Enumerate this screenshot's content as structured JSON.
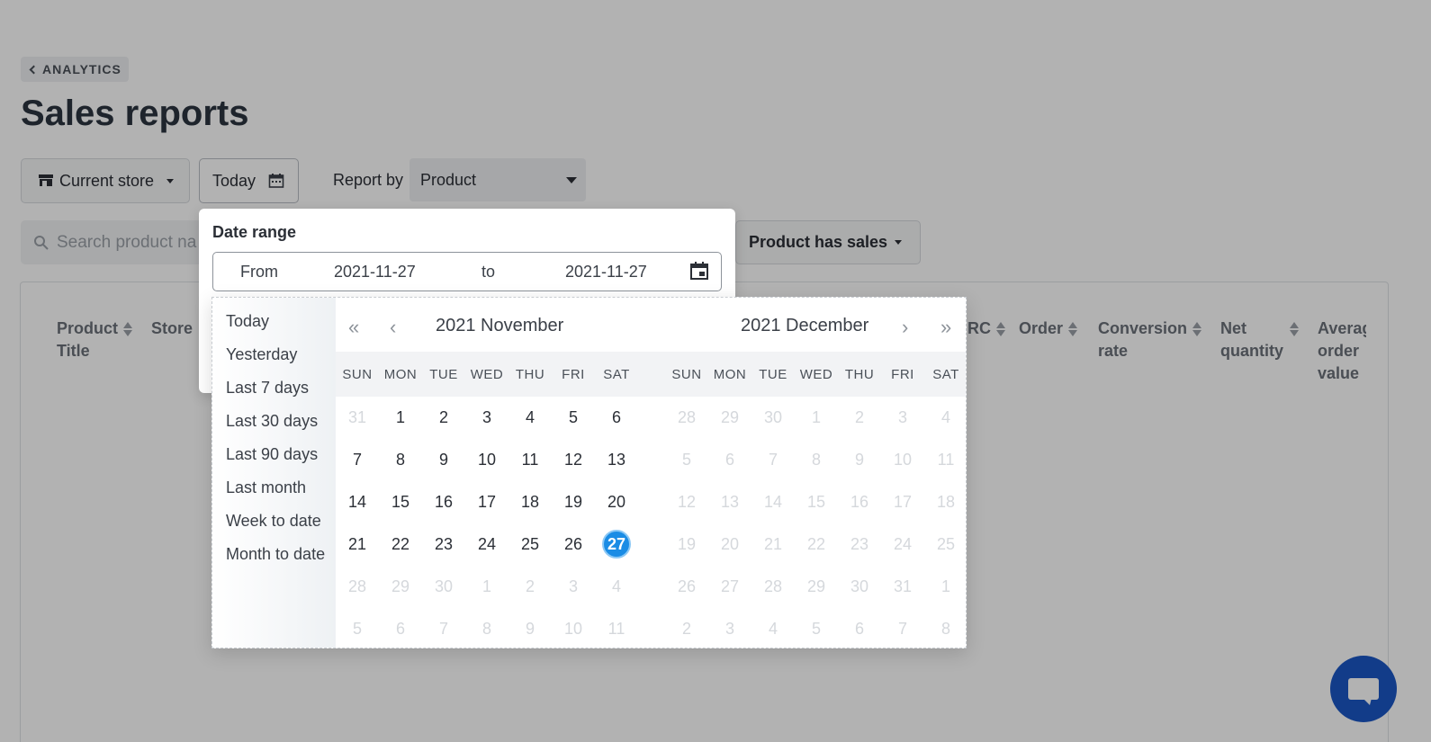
{
  "header": {
    "back_label": "ANALYTICS",
    "title": "Sales reports"
  },
  "toolbar": {
    "store_label": "Current store",
    "date_label": "Today",
    "report_by_label": "Report by",
    "report_by_value": "Product"
  },
  "filters": {
    "search_placeholder": "Search product na",
    "filter_label": "Product has sales"
  },
  "table": {
    "headers": [
      {
        "line1": "Product",
        "line2": "Title",
        "sortable": true
      },
      {
        "line1": "Store",
        "line2": "",
        "sortable": false
      },
      {
        "line1": "RC",
        "line2": "",
        "sortable": true
      },
      {
        "line1": "Order",
        "line2": "",
        "sortable": true
      },
      {
        "line1": "Conversion",
        "line2": "rate",
        "sortable": true
      },
      {
        "line1": "Net",
        "line2": "quantity",
        "sortable": true
      },
      {
        "line1": "Averag",
        "line2": "order",
        "line3": "value",
        "sortable": false
      }
    ]
  },
  "date_range": {
    "title": "Date range",
    "from_label": "From",
    "from_value": "2021-11-27",
    "to_label": "to",
    "to_value": "2021-11-27"
  },
  "calendar": {
    "presets": [
      "Today",
      "Yesterday",
      "Last 7 days",
      "Last 30 days",
      "Last 90 days",
      "Last month",
      "Week to date",
      "Month to date"
    ],
    "weekdays": [
      "SUN",
      "MON",
      "TUE",
      "WED",
      "THU",
      "FRI",
      "SAT"
    ],
    "months": [
      {
        "title": "2021 November",
        "weeks": [
          [
            "31",
            "1",
            "2",
            "3",
            "4",
            "5",
            "6"
          ],
          [
            "7",
            "8",
            "9",
            "10",
            "11",
            "12",
            "13"
          ],
          [
            "14",
            "15",
            "16",
            "17",
            "18",
            "19",
            "20"
          ],
          [
            "21",
            "22",
            "23",
            "24",
            "25",
            "26",
            "27"
          ],
          [
            "28",
            "29",
            "30",
            "1",
            "2",
            "3",
            "4"
          ],
          [
            "5",
            "6",
            "7",
            "8",
            "9",
            "10",
            "11"
          ]
        ],
        "muted": [
          [
            0,
            0
          ],
          [
            4,
            0
          ],
          [
            4,
            1
          ],
          [
            4,
            2
          ],
          [
            4,
            3
          ],
          [
            4,
            4
          ],
          [
            4,
            5
          ],
          [
            4,
            6
          ],
          [
            5,
            0
          ],
          [
            5,
            1
          ],
          [
            5,
            2
          ],
          [
            5,
            3
          ],
          [
            5,
            4
          ],
          [
            5,
            5
          ],
          [
            5,
            6
          ]
        ],
        "selected": [
          3,
          6
        ]
      },
      {
        "title": "2021 December",
        "weeks": [
          [
            "28",
            "29",
            "30",
            "1",
            "2",
            "3",
            "4"
          ],
          [
            "5",
            "6",
            "7",
            "8",
            "9",
            "10",
            "11"
          ],
          [
            "12",
            "13",
            "14",
            "15",
            "16",
            "17",
            "18"
          ],
          [
            "19",
            "20",
            "21",
            "22",
            "23",
            "24",
            "25"
          ],
          [
            "26",
            "27",
            "28",
            "29",
            "30",
            "31",
            "1"
          ],
          [
            "2",
            "3",
            "4",
            "5",
            "6",
            "7",
            "8"
          ]
        ],
        "all_muted": true
      }
    ],
    "nav": {
      "prev_year": "«",
      "prev_month": "‹",
      "next_month": "›",
      "next_year": "»"
    }
  },
  "colors": {
    "accent": "#1a8ce5",
    "chat": "#1a56c4"
  }
}
